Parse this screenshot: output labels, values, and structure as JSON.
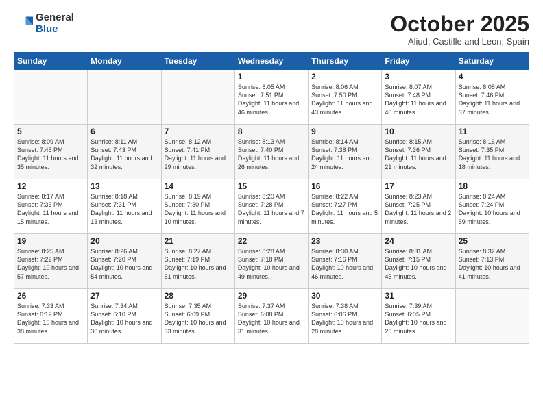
{
  "logo": {
    "general": "General",
    "blue": "Blue"
  },
  "header": {
    "month": "October 2025",
    "location": "Aliud, Castille and Leon, Spain"
  },
  "weekdays": [
    "Sunday",
    "Monday",
    "Tuesday",
    "Wednesday",
    "Thursday",
    "Friday",
    "Saturday"
  ],
  "weeks": [
    [
      {
        "day": "",
        "sunrise": "",
        "sunset": "",
        "daylight": ""
      },
      {
        "day": "",
        "sunrise": "",
        "sunset": "",
        "daylight": ""
      },
      {
        "day": "",
        "sunrise": "",
        "sunset": "",
        "daylight": ""
      },
      {
        "day": "1",
        "sunrise": "Sunrise: 8:05 AM",
        "sunset": "Sunset: 7:51 PM",
        "daylight": "Daylight: 11 hours and 46 minutes."
      },
      {
        "day": "2",
        "sunrise": "Sunrise: 8:06 AM",
        "sunset": "Sunset: 7:50 PM",
        "daylight": "Daylight: 11 hours and 43 minutes."
      },
      {
        "day": "3",
        "sunrise": "Sunrise: 8:07 AM",
        "sunset": "Sunset: 7:48 PM",
        "daylight": "Daylight: 11 hours and 40 minutes."
      },
      {
        "day": "4",
        "sunrise": "Sunrise: 8:08 AM",
        "sunset": "Sunset: 7:46 PM",
        "daylight": "Daylight: 11 hours and 37 minutes."
      }
    ],
    [
      {
        "day": "5",
        "sunrise": "Sunrise: 8:09 AM",
        "sunset": "Sunset: 7:45 PM",
        "daylight": "Daylight: 11 hours and 35 minutes."
      },
      {
        "day": "6",
        "sunrise": "Sunrise: 8:11 AM",
        "sunset": "Sunset: 7:43 PM",
        "daylight": "Daylight: 11 hours and 32 minutes."
      },
      {
        "day": "7",
        "sunrise": "Sunrise: 8:12 AM",
        "sunset": "Sunset: 7:41 PM",
        "daylight": "Daylight: 11 hours and 29 minutes."
      },
      {
        "day": "8",
        "sunrise": "Sunrise: 8:13 AM",
        "sunset": "Sunset: 7:40 PM",
        "daylight": "Daylight: 11 hours and 26 minutes."
      },
      {
        "day": "9",
        "sunrise": "Sunrise: 8:14 AM",
        "sunset": "Sunset: 7:38 PM",
        "daylight": "Daylight: 11 hours and 24 minutes."
      },
      {
        "day": "10",
        "sunrise": "Sunrise: 8:15 AM",
        "sunset": "Sunset: 7:36 PM",
        "daylight": "Daylight: 11 hours and 21 minutes."
      },
      {
        "day": "11",
        "sunrise": "Sunrise: 8:16 AM",
        "sunset": "Sunset: 7:35 PM",
        "daylight": "Daylight: 11 hours and 18 minutes."
      }
    ],
    [
      {
        "day": "12",
        "sunrise": "Sunrise: 8:17 AM",
        "sunset": "Sunset: 7:33 PM",
        "daylight": "Daylight: 11 hours and 15 minutes."
      },
      {
        "day": "13",
        "sunrise": "Sunrise: 8:18 AM",
        "sunset": "Sunset: 7:31 PM",
        "daylight": "Daylight: 11 hours and 13 minutes."
      },
      {
        "day": "14",
        "sunrise": "Sunrise: 8:19 AM",
        "sunset": "Sunset: 7:30 PM",
        "daylight": "Daylight: 11 hours and 10 minutes."
      },
      {
        "day": "15",
        "sunrise": "Sunrise: 8:20 AM",
        "sunset": "Sunset: 7:28 PM",
        "daylight": "Daylight: 11 hours and 7 minutes."
      },
      {
        "day": "16",
        "sunrise": "Sunrise: 8:22 AM",
        "sunset": "Sunset: 7:27 PM",
        "daylight": "Daylight: 11 hours and 5 minutes."
      },
      {
        "day": "17",
        "sunrise": "Sunrise: 8:23 AM",
        "sunset": "Sunset: 7:25 PM",
        "daylight": "Daylight: 11 hours and 2 minutes."
      },
      {
        "day": "18",
        "sunrise": "Sunrise: 8:24 AM",
        "sunset": "Sunset: 7:24 PM",
        "daylight": "Daylight: 10 hours and 59 minutes."
      }
    ],
    [
      {
        "day": "19",
        "sunrise": "Sunrise: 8:25 AM",
        "sunset": "Sunset: 7:22 PM",
        "daylight": "Daylight: 10 hours and 57 minutes."
      },
      {
        "day": "20",
        "sunrise": "Sunrise: 8:26 AM",
        "sunset": "Sunset: 7:20 PM",
        "daylight": "Daylight: 10 hours and 54 minutes."
      },
      {
        "day": "21",
        "sunrise": "Sunrise: 8:27 AM",
        "sunset": "Sunset: 7:19 PM",
        "daylight": "Daylight: 10 hours and 51 minutes."
      },
      {
        "day": "22",
        "sunrise": "Sunrise: 8:28 AM",
        "sunset": "Sunset: 7:18 PM",
        "daylight": "Daylight: 10 hours and 49 minutes."
      },
      {
        "day": "23",
        "sunrise": "Sunrise: 8:30 AM",
        "sunset": "Sunset: 7:16 PM",
        "daylight": "Daylight: 10 hours and 46 minutes."
      },
      {
        "day": "24",
        "sunrise": "Sunrise: 8:31 AM",
        "sunset": "Sunset: 7:15 PM",
        "daylight": "Daylight: 10 hours and 43 minutes."
      },
      {
        "day": "25",
        "sunrise": "Sunrise: 8:32 AM",
        "sunset": "Sunset: 7:13 PM",
        "daylight": "Daylight: 10 hours and 41 minutes."
      }
    ],
    [
      {
        "day": "26",
        "sunrise": "Sunrise: 7:33 AM",
        "sunset": "Sunset: 6:12 PM",
        "daylight": "Daylight: 10 hours and 38 minutes."
      },
      {
        "day": "27",
        "sunrise": "Sunrise: 7:34 AM",
        "sunset": "Sunset: 6:10 PM",
        "daylight": "Daylight: 10 hours and 36 minutes."
      },
      {
        "day": "28",
        "sunrise": "Sunrise: 7:35 AM",
        "sunset": "Sunset: 6:09 PM",
        "daylight": "Daylight: 10 hours and 33 minutes."
      },
      {
        "day": "29",
        "sunrise": "Sunrise: 7:37 AM",
        "sunset": "Sunset: 6:08 PM",
        "daylight": "Daylight: 10 hours and 31 minutes."
      },
      {
        "day": "30",
        "sunrise": "Sunrise: 7:38 AM",
        "sunset": "Sunset: 6:06 PM",
        "daylight": "Daylight: 10 hours and 28 minutes."
      },
      {
        "day": "31",
        "sunrise": "Sunrise: 7:39 AM",
        "sunset": "Sunset: 6:05 PM",
        "daylight": "Daylight: 10 hours and 25 minutes."
      },
      {
        "day": "",
        "sunrise": "",
        "sunset": "",
        "daylight": ""
      }
    ]
  ]
}
